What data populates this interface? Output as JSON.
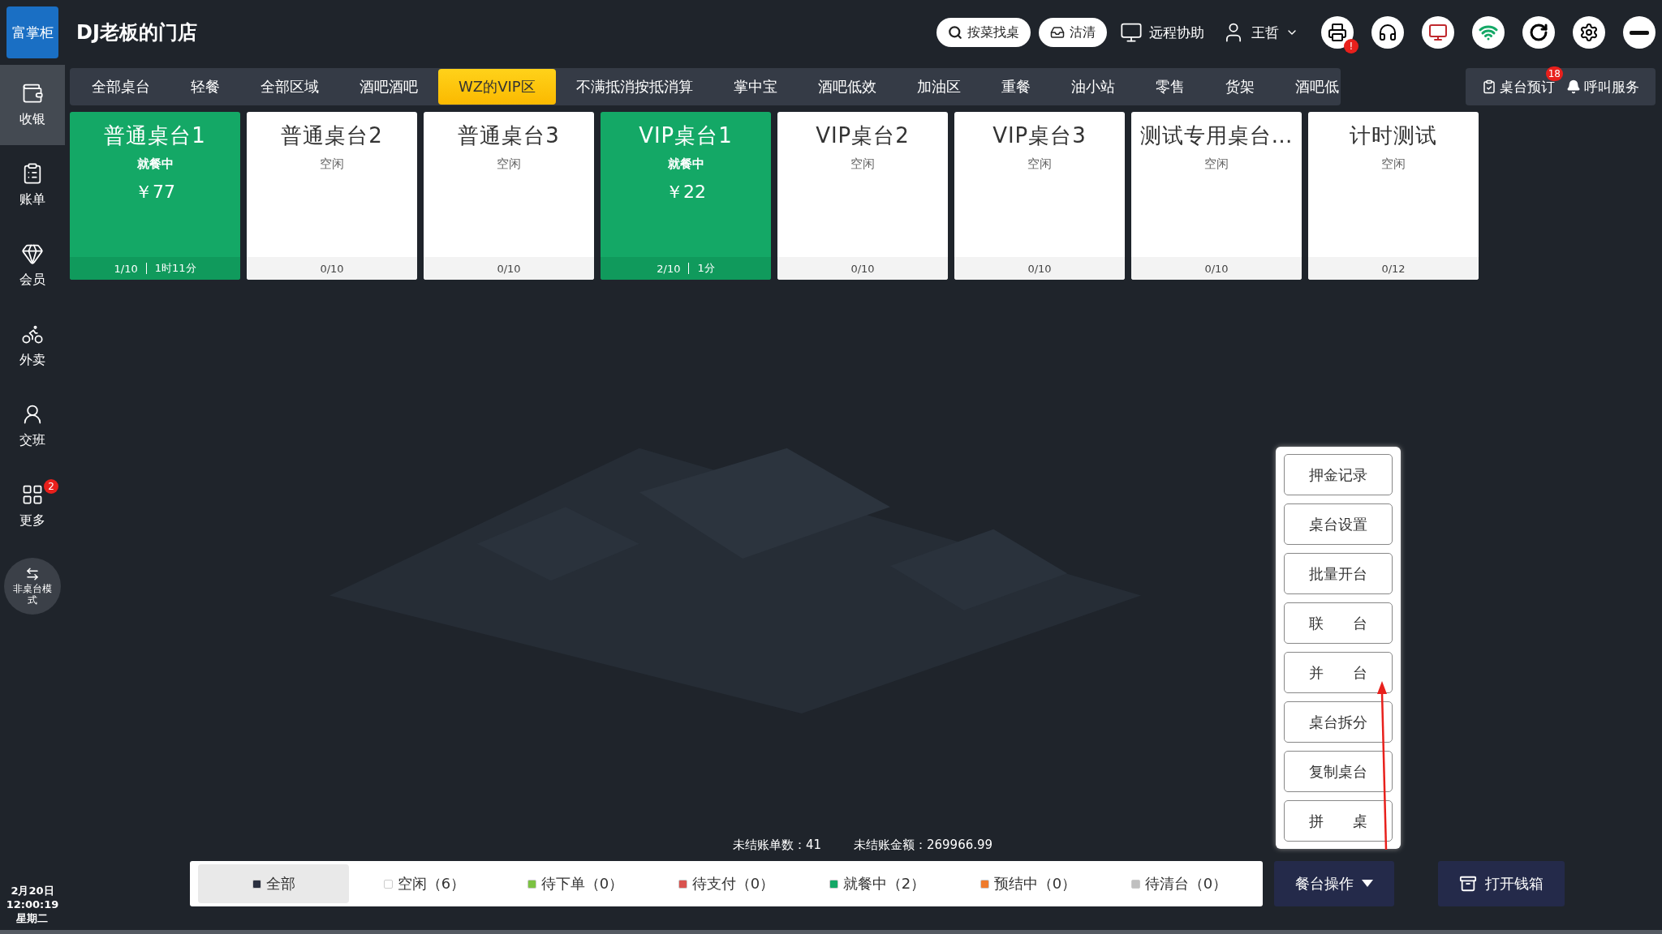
{
  "header": {
    "logo": "富掌柜",
    "store": "DJ老板的门店",
    "search_button": "按菜找桌",
    "clean_button": "沽清",
    "remote": "远程协助",
    "user": "王哲",
    "printer_alert": "!"
  },
  "sidebar": {
    "items": [
      {
        "label": "收银",
        "selected": true
      },
      {
        "label": "账单",
        "selected": false
      },
      {
        "label": "会员",
        "selected": false
      },
      {
        "label": "外卖",
        "selected": false
      },
      {
        "label": "交班",
        "selected": false
      },
      {
        "label": "更多",
        "selected": false,
        "badge": "2"
      }
    ],
    "mode_button": "非桌台模式",
    "date": "2月20日",
    "time": "12:00:19",
    "weekday": "星期二"
  },
  "area_tabs": [
    {
      "label": "全部桌台",
      "selected": false
    },
    {
      "label": "轻餐",
      "selected": false
    },
    {
      "label": "全部区域",
      "selected": false
    },
    {
      "label": "酒吧酒吧",
      "selected": false
    },
    {
      "label": "WZ的VIP区",
      "selected": true
    },
    {
      "label": "不满抵消按抵消算",
      "selected": false
    },
    {
      "label": "掌中宝",
      "selected": false
    },
    {
      "label": "酒吧低效",
      "selected": false
    },
    {
      "label": "加油区",
      "selected": false
    },
    {
      "label": "重餐",
      "selected": false
    },
    {
      "label": "油小站",
      "selected": false
    },
    {
      "label": "零售",
      "selected": false
    },
    {
      "label": "货架",
      "selected": false
    },
    {
      "label": "酒吧低",
      "selected": false
    }
  ],
  "reservation": {
    "label": "桌台预订",
    "badge": "18"
  },
  "call_service": "呼叫服务",
  "tables": [
    {
      "kind": "dining",
      "name": "普通桌台1",
      "status": "就餐中",
      "amount": "￥77",
      "seats": "1/10",
      "duration": "1时11分"
    },
    {
      "kind": "idle",
      "name": "普通桌台2",
      "status": "空闲",
      "seats": "0/10"
    },
    {
      "kind": "idle",
      "name": "普通桌台3",
      "status": "空闲",
      "seats": "0/10"
    },
    {
      "kind": "dining",
      "name": "VIP桌台1",
      "status": "就餐中",
      "amount": "￥22",
      "seats": "2/10",
      "duration": "1分"
    },
    {
      "kind": "idle",
      "name": "VIP桌台2",
      "status": "空闲",
      "seats": "0/10"
    },
    {
      "kind": "idle",
      "name": "VIP桌台3",
      "status": "空闲",
      "seats": "0/10"
    },
    {
      "kind": "idle",
      "name": "测试专用桌台…",
      "status": "空闲",
      "seats": "0/10"
    },
    {
      "kind": "idle",
      "name": "计时测试",
      "status": "空闲",
      "seats": "0/12"
    }
  ],
  "action_menu": [
    "押金记录",
    "桌台设置",
    "批量开台",
    "联　　台",
    "并　　台",
    "桌台拆分",
    "复制桌台",
    "拼　　桌"
  ],
  "summary": {
    "unsettled_count": "未结账单数：41",
    "unsettled_amount": "未结账金额：269966.99"
  },
  "filters": [
    {
      "label": "全部",
      "color": "#2b3040",
      "selected": true
    },
    {
      "label": "空闲（6）",
      "color": "#ffffff",
      "selected": false
    },
    {
      "label": "待下单（0）",
      "color": "#7cc242",
      "selected": false
    },
    {
      "label": "待支付（0）",
      "color": "#d9534f",
      "selected": false
    },
    {
      "label": "就餐中（2）",
      "color": "#14a866",
      "selected": false
    },
    {
      "label": "预结中（0）",
      "color": "#ef7b2c",
      "selected": false
    },
    {
      "label": "待清台（0）",
      "color": "#c0c0c0",
      "selected": false
    }
  ],
  "table_actions_button": "餐台操作",
  "cash_drawer_button": "打开钱箱"
}
